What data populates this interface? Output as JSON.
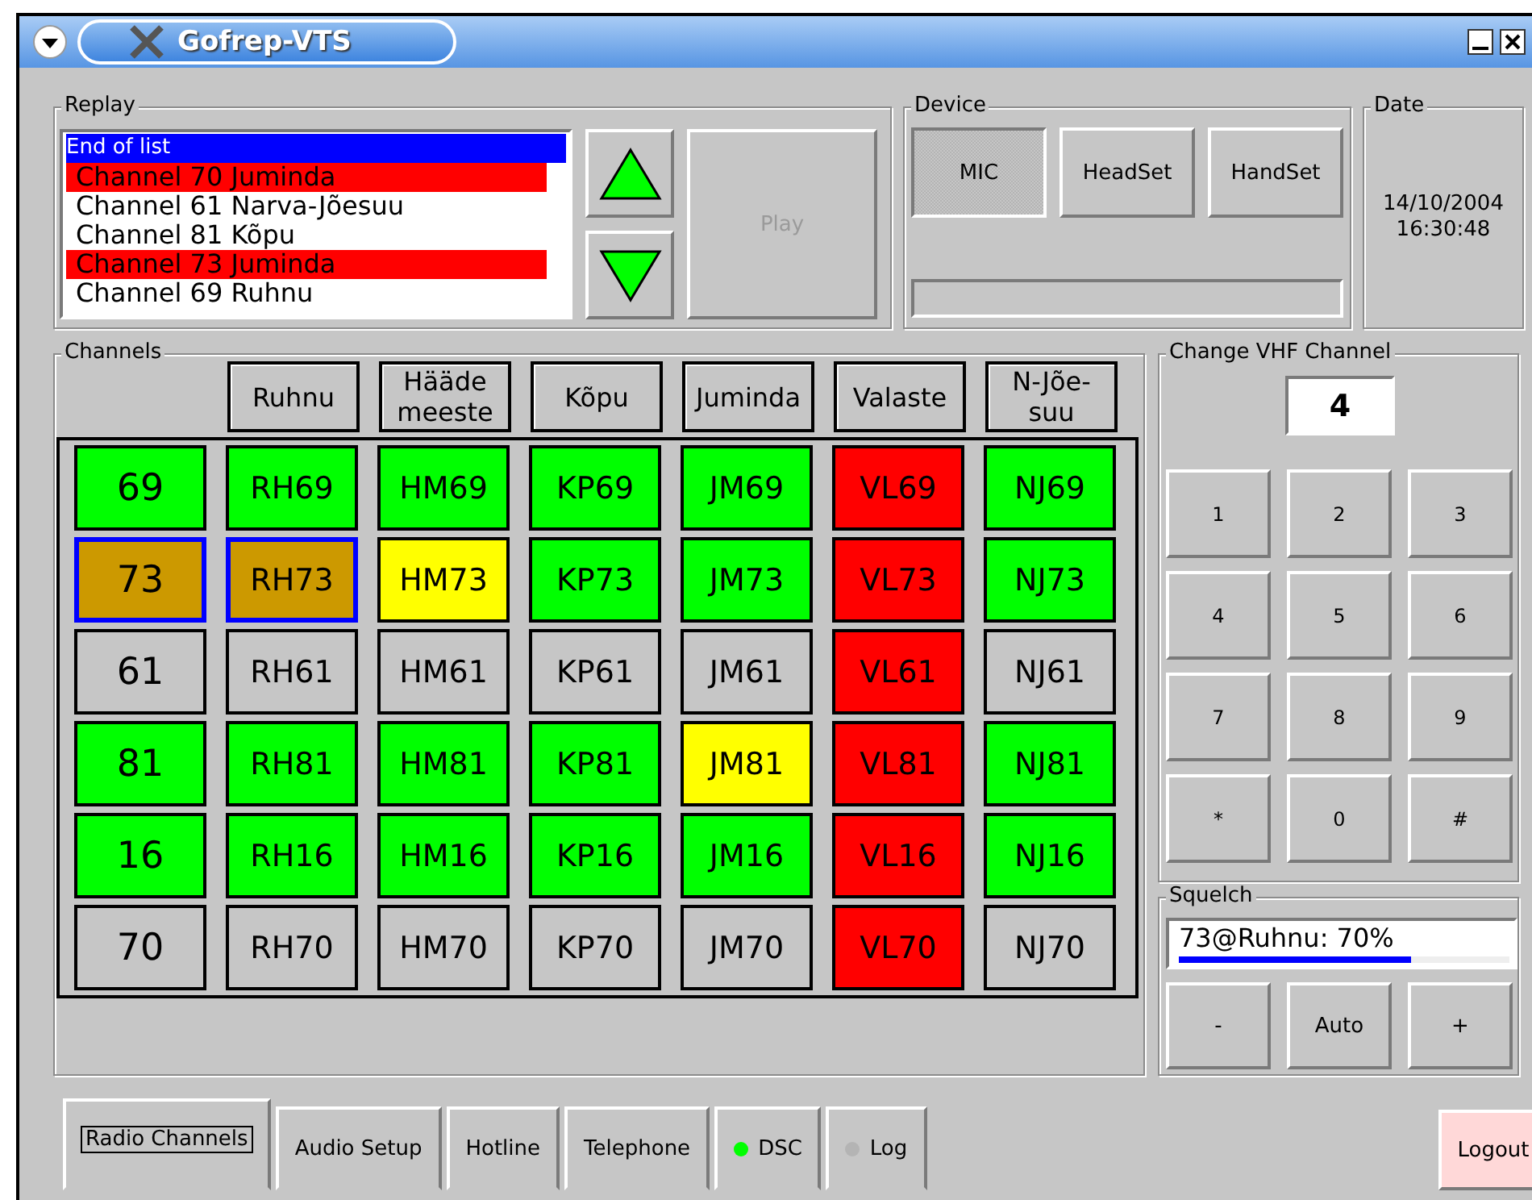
{
  "window": {
    "title": "Gofrep-VTS"
  },
  "replay": {
    "title": "Replay",
    "items": [
      {
        "text": "End of list",
        "selected": true,
        "color": "#0000ff"
      },
      {
        "text": "Channel 70 Juminda",
        "selected": false,
        "color": "#ff0000"
      },
      {
        "text": "Channel 61 Narva-Jõesuu",
        "selected": false,
        "color": "#ffffff"
      },
      {
        "text": "Channel 81 Kõpu",
        "selected": false,
        "color": "#ffffff"
      },
      {
        "text": "Channel 73 Juminda",
        "selected": false,
        "color": "#ff0000"
      },
      {
        "text": "Channel 69 Ruhnu",
        "selected": false,
        "color": "#ffffff"
      }
    ],
    "play": {
      "label": "Play",
      "disabled": true
    }
  },
  "device": {
    "title": "Device",
    "buttons": [
      {
        "label": "MIC",
        "selected": true
      },
      {
        "label": "HeadSet",
        "selected": false
      },
      {
        "label": "HandSet",
        "selected": false
      }
    ]
  },
  "date": {
    "title": "Date",
    "date": "14/10/2004",
    "time": "16:30:48"
  },
  "channels": {
    "title": "Channels",
    "columns": [
      "",
      "Ruhnu",
      "Hääde meeste",
      "Kõpu",
      "Juminda",
      "Valaste",
      "N-Jõe-suu"
    ],
    "rows": [
      {
        "cells": [
          {
            "label": "69",
            "color": "#00ff00",
            "selected": false
          },
          {
            "label": "RH69",
            "color": "#00ff00",
            "selected": false
          },
          {
            "label": "HM69",
            "color": "#00ff00",
            "selected": false
          },
          {
            "label": "KP69",
            "color": "#00ff00",
            "selected": false
          },
          {
            "label": "JM69",
            "color": "#00ff00",
            "selected": false
          },
          {
            "label": "VL69",
            "color": "#ff0000",
            "selected": false
          },
          {
            "label": "NJ69",
            "color": "#00ff00",
            "selected": false
          }
        ]
      },
      {
        "cells": [
          {
            "label": "73",
            "color": "#cc9900",
            "selected": true
          },
          {
            "label": "RH73",
            "color": "#cc9900",
            "selected": true
          },
          {
            "label": "HM73",
            "color": "#ffff00",
            "selected": false
          },
          {
            "label": "KP73",
            "color": "#00ff00",
            "selected": false
          },
          {
            "label": "JM73",
            "color": "#00ff00",
            "selected": false
          },
          {
            "label": "VL73",
            "color": "#ff0000",
            "selected": false
          },
          {
            "label": "NJ73",
            "color": "#00ff00",
            "selected": false
          }
        ]
      },
      {
        "cells": [
          {
            "label": "61",
            "color": "#c6c6c6",
            "selected": false
          },
          {
            "label": "RH61",
            "color": "#c6c6c6",
            "selected": false
          },
          {
            "label": "HM61",
            "color": "#c6c6c6",
            "selected": false
          },
          {
            "label": "KP61",
            "color": "#c6c6c6",
            "selected": false
          },
          {
            "label": "JM61",
            "color": "#c6c6c6",
            "selected": false
          },
          {
            "label": "VL61",
            "color": "#ff0000",
            "selected": false
          },
          {
            "label": "NJ61",
            "color": "#c6c6c6",
            "selected": false
          }
        ]
      },
      {
        "cells": [
          {
            "label": "81",
            "color": "#00ff00",
            "selected": false
          },
          {
            "label": "RH81",
            "color": "#00ff00",
            "selected": false
          },
          {
            "label": "HM81",
            "color": "#00ff00",
            "selected": false
          },
          {
            "label": "KP81",
            "color": "#00ff00",
            "selected": false
          },
          {
            "label": "JM81",
            "color": "#ffff00",
            "selected": false
          },
          {
            "label": "VL81",
            "color": "#ff0000",
            "selected": false
          },
          {
            "label": "NJ81",
            "color": "#00ff00",
            "selected": false
          }
        ]
      },
      {
        "cells": [
          {
            "label": "16",
            "color": "#00ff00",
            "selected": false
          },
          {
            "label": "RH16",
            "color": "#00ff00",
            "selected": false
          },
          {
            "label": "HM16",
            "color": "#00ff00",
            "selected": false
          },
          {
            "label": "KP16",
            "color": "#00ff00",
            "selected": false
          },
          {
            "label": "JM16",
            "color": "#00ff00",
            "selected": false
          },
          {
            "label": "VL16",
            "color": "#ff0000",
            "selected": false
          },
          {
            "label": "NJ16",
            "color": "#00ff00",
            "selected": false
          }
        ]
      },
      {
        "cells": [
          {
            "label": "70",
            "color": "#c6c6c6",
            "selected": false
          },
          {
            "label": "RH70",
            "color": "#c6c6c6",
            "selected": false
          },
          {
            "label": "HM70",
            "color": "#c6c6c6",
            "selected": false
          },
          {
            "label": "KP70",
            "color": "#c6c6c6",
            "selected": false
          },
          {
            "label": "JM70",
            "color": "#c6c6c6",
            "selected": false
          },
          {
            "label": "VL70",
            "color": "#ff0000",
            "selected": false
          },
          {
            "label": "NJ70",
            "color": "#c6c6c6",
            "selected": false
          }
        ]
      }
    ]
  },
  "vhf": {
    "title": "Change VHF Channel",
    "value": "4",
    "keys": [
      "1",
      "2",
      "3",
      "4",
      "5",
      "6",
      "7",
      "8",
      "9",
      "*",
      "0",
      "#"
    ]
  },
  "squelch": {
    "title": "Squelch",
    "reading": "73@Ruhnu: 70%",
    "level": 0.7,
    "buttons": [
      "-",
      "Auto",
      "+"
    ]
  },
  "tabs": [
    {
      "label": "Radio Channels",
      "selected": true
    },
    {
      "label": "Audio Setup",
      "selected": false
    },
    {
      "label": "Hotline",
      "selected": false
    },
    {
      "label": "Telephone",
      "selected": false
    },
    {
      "label": "DSC",
      "selected": false,
      "color": "#00ff00"
    },
    {
      "label": "Log",
      "selected": false,
      "color": "#b4b4b4"
    }
  ],
  "logout": {
    "label": "Logout"
  }
}
